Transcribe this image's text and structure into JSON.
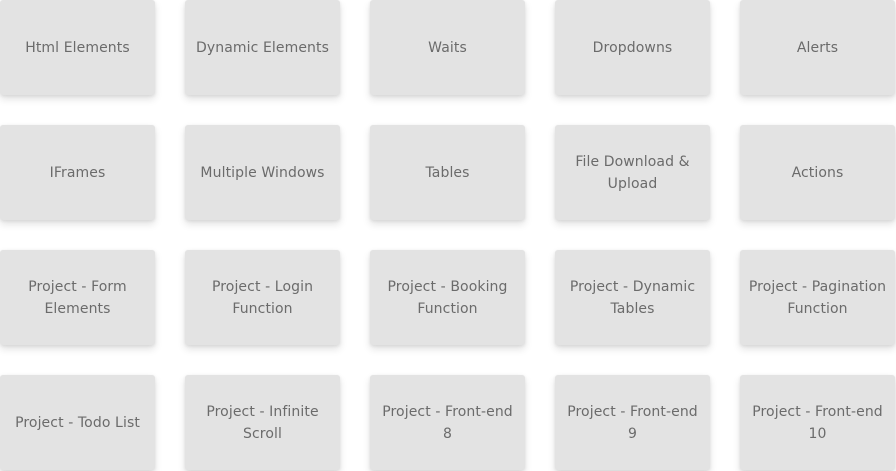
{
  "cards": [
    {
      "label": "Html Elements"
    },
    {
      "label": "Dynamic Elements"
    },
    {
      "label": "Waits"
    },
    {
      "label": "Dropdowns"
    },
    {
      "label": "Alerts"
    },
    {
      "label": "IFrames"
    },
    {
      "label": "Multiple Windows"
    },
    {
      "label": "Tables"
    },
    {
      "label": "File Download & Upload"
    },
    {
      "label": "Actions"
    },
    {
      "label": "Project - Form Elements"
    },
    {
      "label": "Project - Login Function"
    },
    {
      "label": "Project - Booking Function"
    },
    {
      "label": "Project - Dynamic Tables"
    },
    {
      "label": "Project - Pagination Function"
    },
    {
      "label": "Project - Todo List"
    },
    {
      "label": "Project - Infinite Scroll"
    },
    {
      "label": "Project - Front-end 8"
    },
    {
      "label": "Project - Front-end 9"
    },
    {
      "label": "Project - Front-end 10"
    }
  ],
  "colors": {
    "card_background": "#e3e3e3",
    "card_text": "#6b6b6b",
    "page_background": "#ffffff"
  }
}
